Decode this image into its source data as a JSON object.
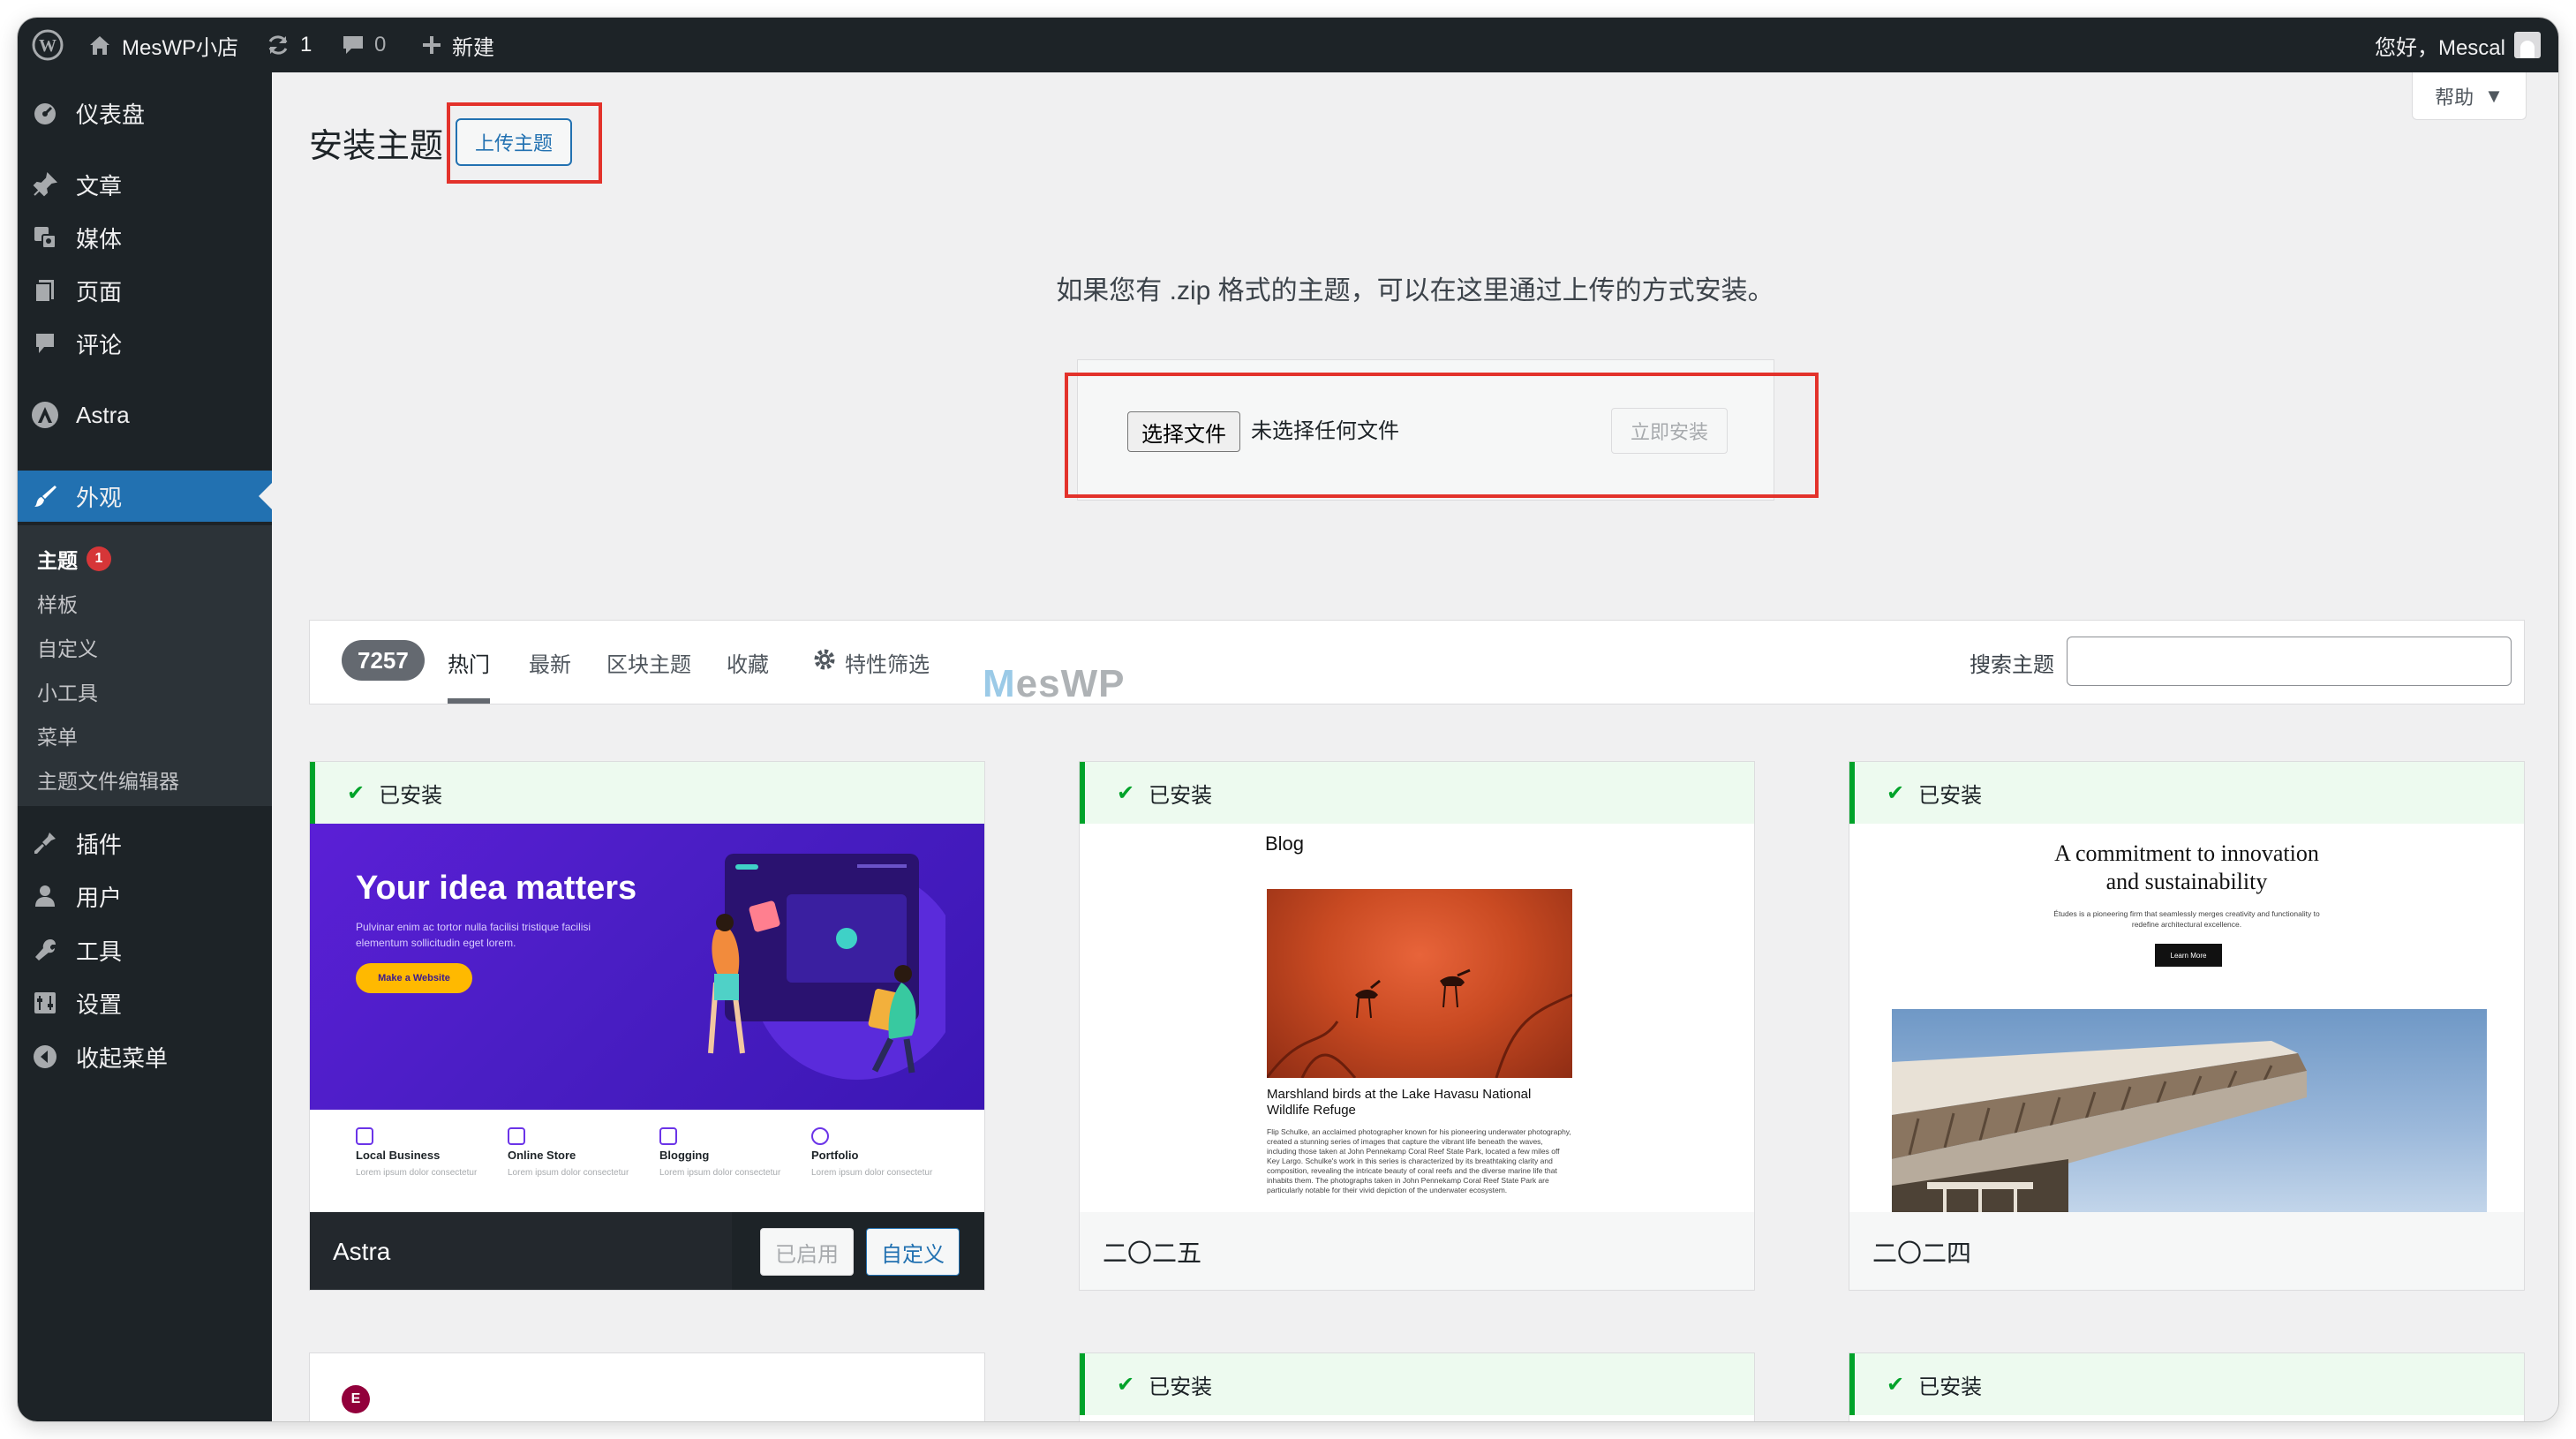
{
  "admin_bar": {
    "site_name": "MesWP小店",
    "updates_count": "1",
    "comments_count": "0",
    "new_label": "新建",
    "greeting": "您好，Mescal"
  },
  "sidebar": {
    "items": [
      {
        "label": "仪表盘",
        "icon": "dashboard-icon"
      },
      {
        "label": "文章",
        "icon": "pin-icon"
      },
      {
        "label": "媒体",
        "icon": "media-icon"
      },
      {
        "label": "页面",
        "icon": "page-icon"
      },
      {
        "label": "评论",
        "icon": "comment-icon"
      },
      {
        "label": "Astra",
        "icon": "astra-icon"
      },
      {
        "label": "外观",
        "icon": "brush-icon"
      },
      {
        "label": "插件",
        "icon": "plugin-icon"
      },
      {
        "label": "用户",
        "icon": "user-icon"
      },
      {
        "label": "工具",
        "icon": "wrench-icon"
      },
      {
        "label": "设置",
        "icon": "settings-icon"
      },
      {
        "label": "收起菜单",
        "icon": "collapse-icon"
      }
    ],
    "submenu": [
      {
        "label": "主题",
        "badge": "1"
      },
      {
        "label": "样板"
      },
      {
        "label": "自定义"
      },
      {
        "label": "小工具"
      },
      {
        "label": "菜单"
      },
      {
        "label": "主题文件编辑器"
      }
    ]
  },
  "page": {
    "title": "安装主题",
    "upload_button": "上传主题",
    "help_label": "帮助"
  },
  "upload": {
    "description": "如果您有 .zip 格式的主题，可以在这里通过上传的方式安装。",
    "choose_file": "选择文件",
    "no_file": "未选择任何文件",
    "install_now": "立即安装"
  },
  "filter": {
    "count": "7257",
    "tabs": [
      "热门",
      "最新",
      "区块主题",
      "收藏",
      "特性筛选"
    ],
    "search_label": "搜索主题"
  },
  "themes": [
    {
      "name": "Astra",
      "installed_label": "已安装",
      "activated_label": "已启用",
      "customize_label": "自定义",
      "preview": {
        "headline": "Your idea matters",
        "text": "Pulvinar enim ac tortor nulla facilisi tristique facilisi elementum sollicitudin eget lorem.",
        "cta": "Make a Website",
        "services": [
          "Local Business",
          "Online Store",
          "Blogging",
          "Portfolio"
        ],
        "service_sub": "Lorem ipsum dolor consectetur"
      }
    },
    {
      "name": "二〇二五",
      "installed_label": "已安装",
      "preview": {
        "blog_title": "Blog",
        "caption": "Marshland birds at the Lake Havasu National Wildlife Refuge",
        "body": "Flip Schulke, an acclaimed photographer known for his pioneering underwater photography, created a stunning series of images that capture the vibrant life beneath the waves, including those taken at John Pennekamp Coral Reef State Park, located a few miles off Key Largo. Schulke's work in this series is characterized by its breathtaking clarity and composition, revealing the intricate beauty of coral reefs and the diverse marine life that inhabits them. The photographs taken in John Pennekamp Coral Reef State Park are particularly notable for their vivid depiction of the underwater ecosystem."
      }
    },
    {
      "name": "二〇二四",
      "installed_label": "已安装",
      "preview": {
        "title_line1": "A commitment to innovation",
        "title_line2": "and sustainability",
        "sub": "Études is a pioneering firm that seamlessly merges creativity and functionality to redefine architectural excellence.",
        "button": "Learn More"
      }
    }
  ],
  "bottom_row": [
    {
      "installed": false,
      "logo": "elementor-icon"
    },
    {
      "installed": true,
      "installed_label": "已安装"
    },
    {
      "installed": true,
      "installed_label": "已安装"
    }
  ],
  "watermark": {
    "prefix": "M",
    "rest": "esWP"
  },
  "colors": {
    "admin_dark": "#1d2327",
    "accent_blue": "#2271b1",
    "installed_green": "#00a32a",
    "highlight_red": "#e3322b",
    "badge_red": "#d63638"
  }
}
